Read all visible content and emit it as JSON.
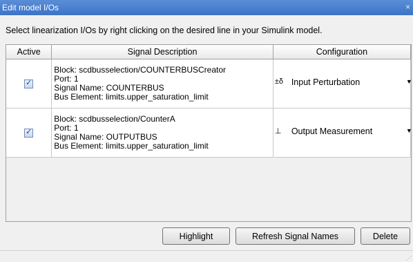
{
  "window": {
    "title": "Edit model I/Os",
    "close": "×"
  },
  "instruction": "Select linearization I/Os by right clicking on the desired line in your Simulink model.",
  "table": {
    "headers": [
      "Active",
      "Signal Description",
      "Configuration"
    ],
    "rows": [
      {
        "active": true,
        "block": "Block: scdbusselection/COUNTERBUSCreator",
        "port": "Port: 1",
        "signal_name": "Signal Name: COUNTERBUS",
        "bus_element": "Bus Element: limits.upper_saturation_limit",
        "configuration": "Input Perturbation",
        "config_icon": "±δ",
        "config_icon_name": "input-perturbation-icon"
      },
      {
        "active": true,
        "block": "Block: scdbusselection/CounterA",
        "port": "Port: 1",
        "signal_name": "Signal Name: OUTPUTBUS",
        "bus_element": "Bus Element: limits.upper_saturation_limit",
        "configuration": "Output Measurement",
        "config_icon": "⊥",
        "config_icon_name": "output-measurement-icon"
      }
    ]
  },
  "buttons": {
    "highlight": "Highlight",
    "refresh": "Refresh Signal Names",
    "delete": "Delete"
  }
}
